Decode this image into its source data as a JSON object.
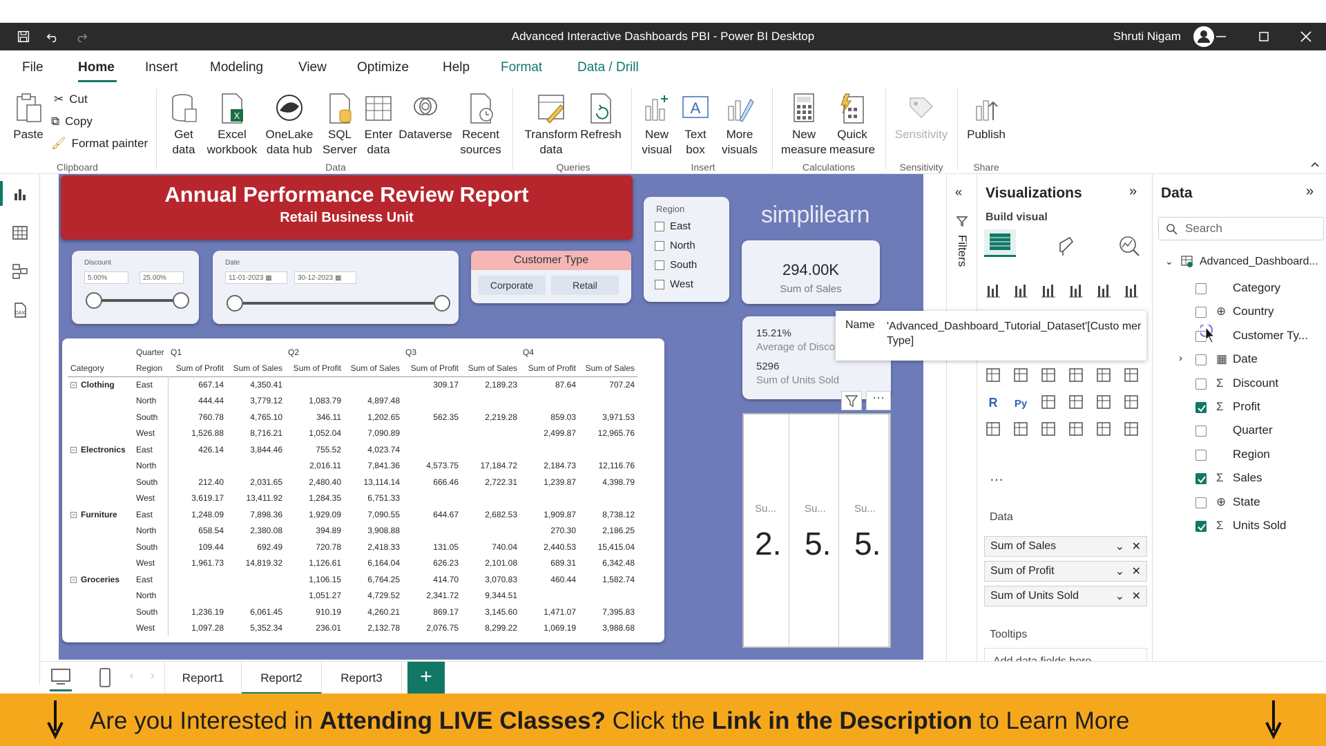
{
  "window": {
    "title": "Advanced Interactive Dashboards PBI - Power BI Desktop",
    "user": "Shruti Nigam"
  },
  "menu": [
    "File",
    "Home",
    "Insert",
    "Modeling",
    "View",
    "Optimize",
    "Help",
    "Format",
    "Data / Drill"
  ],
  "ribbon": {
    "clipboard": {
      "paste": "Paste",
      "cut": "Cut",
      "copy": "Copy",
      "format_painter": "Format painter",
      "group": "Clipboard"
    },
    "data": {
      "get_data": "Get data",
      "excel": "Excel workbook",
      "onelake": "OneLake data hub",
      "sql": "SQL Server",
      "enter": "Enter data",
      "dataverse": "Dataverse",
      "recent": "Recent sources",
      "group": "Data"
    },
    "queries": {
      "transform": "Transform data",
      "refresh": "Refresh",
      "group": "Queries"
    },
    "insert": {
      "new_visual": "New visual",
      "text_box": "Text box",
      "more_visuals": "More visuals",
      "group": "Insert"
    },
    "calculations": {
      "new_measure": "New measure",
      "quick_measure": "Quick measure",
      "group": "Calculations"
    },
    "sensitivity": {
      "label": "Sensitivity",
      "group": "Sensitivity"
    },
    "share": {
      "publish": "Publish",
      "group": "Share"
    }
  },
  "report": {
    "title": "Annual Performance Review Report",
    "subtitle": "Retail Business Unit",
    "discount": {
      "label": "Discount",
      "min": "5.00%",
      "max": "25.00%"
    },
    "date": {
      "label": "Date",
      "start": "11-01-2023",
      "end": "30-12-2023"
    },
    "customer_type": {
      "label": "Customer Type",
      "options": [
        "Corporate",
        "Retail"
      ]
    },
    "region": {
      "label": "Region",
      "options": [
        "East",
        "North",
        "South",
        "West"
      ]
    },
    "logo": "simplilearn",
    "kpi_sales": {
      "value": "294.00K",
      "label": "Sum of Sales"
    },
    "kpi_small": {
      "discount_value": "15.21%",
      "discount_label": "Average of Disco",
      "units_value": "5296",
      "units_label": "Sum of Units Sold"
    },
    "big_cards": [
      {
        "label": "Su...",
        "value": "2."
      },
      {
        "label": "Su...",
        "value": "5."
      },
      {
        "label": "Su...",
        "value": "5."
      }
    ]
  },
  "matrix": {
    "header_quarter": "Quarter",
    "header_category": "Category",
    "header_region": "Region",
    "quarters": [
      "Q1",
      "Q2",
      "Q3",
      "Q4"
    ],
    "measures": [
      "Sum of Profit",
      "Sum of Sales"
    ],
    "rows": [
      {
        "category": "Clothing",
        "region": "East",
        "values": [
          "667.14",
          "4,350.41",
          "",
          "",
          "309.17",
          "2,189.23",
          "87.64",
          "707.24"
        ]
      },
      {
        "category": "",
        "region": "North",
        "values": [
          "444.44",
          "3,779.12",
          "1,083.79",
          "4,897.48",
          "",
          "",
          "",
          ""
        ]
      },
      {
        "category": "",
        "region": "South",
        "values": [
          "760.78",
          "4,765.10",
          "346.11",
          "1,202.65",
          "562.35",
          "2,219.28",
          "859.03",
          "3,971.53"
        ]
      },
      {
        "category": "",
        "region": "West",
        "values": [
          "1,526.88",
          "8,716.21",
          "1,052.04",
          "7,090.89",
          "",
          "",
          "2,499.87",
          "12,965.76"
        ]
      },
      {
        "category": "Electronics",
        "region": "East",
        "values": [
          "426.14",
          "3,844.46",
          "755.52",
          "4,023.74",
          "",
          "",
          "",
          ""
        ]
      },
      {
        "category": "",
        "region": "North",
        "values": [
          "",
          "",
          "2,016.11",
          "7,841.36",
          "4,573.75",
          "17,184.72",
          "2,184.73",
          "12,116.76"
        ]
      },
      {
        "category": "",
        "region": "South",
        "values": [
          "212.40",
          "2,031.65",
          "2,480.40",
          "13,114.14",
          "666.46",
          "2,722.31",
          "1,239.87",
          "4,398.79"
        ]
      },
      {
        "category": "",
        "region": "West",
        "values": [
          "3,619.17",
          "13,411.92",
          "1,284.35",
          "6,751.33",
          "",
          "",
          "",
          ""
        ]
      },
      {
        "category": "Furniture",
        "region": "East",
        "values": [
          "1,248.09",
          "7,898.36",
          "1,929.09",
          "7,090.55",
          "644.67",
          "2,682.53",
          "1,909.87",
          "8,738.12"
        ]
      },
      {
        "category": "",
        "region": "North",
        "values": [
          "658.54",
          "2,380.08",
          "394.89",
          "3,908.88",
          "",
          "",
          "270.30",
          "2,186.25"
        ]
      },
      {
        "category": "",
        "region": "South",
        "values": [
          "109.44",
          "692.49",
          "720.78",
          "2,418.33",
          "131.05",
          "740.04",
          "2,440.53",
          "15,415.04"
        ]
      },
      {
        "category": "",
        "region": "West",
        "values": [
          "1,961.73",
          "14,819.32",
          "1,126.61",
          "6,164.04",
          "626.23",
          "2,101.08",
          "689.31",
          "6,342.48"
        ]
      },
      {
        "category": "Groceries",
        "region": "East",
        "values": [
          "",
          "",
          "1,106.15",
          "6,764.25",
          "414.70",
          "3,070.83",
          "460.44",
          "1,582.74"
        ]
      },
      {
        "category": "",
        "region": "North",
        "values": [
          "",
          "",
          "1,051.27",
          "4,729.52",
          "2,341.72",
          "9,344.51",
          "",
          ""
        ]
      },
      {
        "category": "",
        "region": "South",
        "values": [
          "1,236.19",
          "6,061.45",
          "910.19",
          "4,260.21",
          "869.17",
          "3,145.60",
          "1,471.07",
          "7,395.83"
        ]
      },
      {
        "category": "",
        "region": "West",
        "values": [
          "1,097.28",
          "5,352.34",
          "236.01",
          "2,132.78",
          "2,076.75",
          "8,299.22",
          "1,069.19",
          "3,988.68"
        ]
      }
    ]
  },
  "tooltip": {
    "label": "Name",
    "value": "'Advanced_Dashboard_Tutorial_Dataset'[Custo mer Type]"
  },
  "filters": {
    "label": "Filters"
  },
  "visualizations": {
    "title": "Visualizations",
    "build": "Build visual",
    "data_label": "Data",
    "wells": [
      "Sum of Sales",
      "Sum of Profit",
      "Sum of Units Sold"
    ],
    "tooltips_label": "Tooltips",
    "tooltips_placeholder": "Add data fields here"
  },
  "data_pane": {
    "title": "Data",
    "search_placeholder": "Search",
    "table": "Advanced_Dashboard...",
    "fields": [
      {
        "name": "Category",
        "checked": false,
        "glyph": ""
      },
      {
        "name": "Country",
        "checked": false,
        "glyph": "globe"
      },
      {
        "name": "Customer Ty...",
        "checked": false,
        "glyph": ""
      },
      {
        "name": "Date",
        "checked": false,
        "glyph": "calendar"
      },
      {
        "name": "Discount",
        "checked": false,
        "glyph": "sigma"
      },
      {
        "name": "Profit",
        "checked": true,
        "glyph": "sigma"
      },
      {
        "name": "Quarter",
        "checked": false,
        "glyph": ""
      },
      {
        "name": "Region",
        "checked": false,
        "glyph": ""
      },
      {
        "name": "Sales",
        "checked": true,
        "glyph": "sigma"
      },
      {
        "name": "State",
        "checked": false,
        "glyph": "globe"
      },
      {
        "name": "Units Sold",
        "checked": true,
        "glyph": "sigma"
      }
    ]
  },
  "tabs": [
    "Report1",
    "Report2",
    "Report3"
  ],
  "banner": {
    "p1": "Are you Interested in ",
    "b1": "Attending LIVE Classes?",
    "p2": " Click the ",
    "b2": "Link in the Description",
    "p3": " to Learn More"
  },
  "colors": {
    "accent": "#117865",
    "header": "#b7262d",
    "canvas": "#6d7bb8",
    "banner": "#f6a81d"
  }
}
